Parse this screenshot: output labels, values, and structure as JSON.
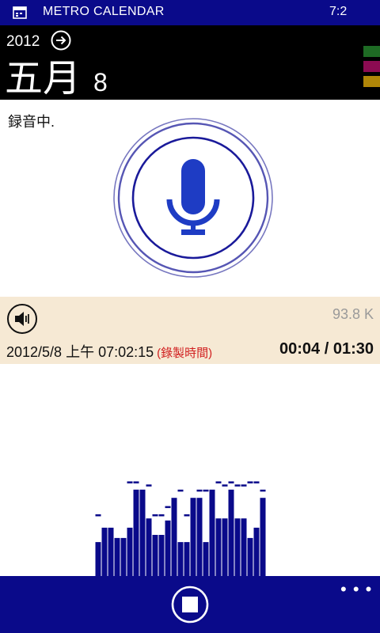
{
  "status_bar": {
    "app_title": "METRO CALENDAR",
    "time": "7:2"
  },
  "header": {
    "year": "2012",
    "month": "五月",
    "day": "8"
  },
  "calendar_colors": [
    "#1e6b24",
    "#8c0b52",
    "#b08608"
  ],
  "recording": {
    "status": "録音中."
  },
  "info": {
    "file_size": "93.8 K",
    "datetime": "2012/5/8 上午 07:02:15",
    "note": "(錄製時間)",
    "duration": "00:04 / 01:30"
  },
  "levels": {
    "bars": [
      0.33,
      0.47,
      0.47,
      0.37,
      0.37,
      0.47,
      0.84,
      0.84,
      0.56,
      0.4,
      0.4,
      0.54,
      0.76,
      0.33,
      0.33,
      0.76,
      0.76,
      0.33,
      0.84,
      0.56,
      0.56,
      0.84,
      0.56,
      0.56,
      0.37,
      0.47,
      0.76
    ],
    "peaks": [
      0.6,
      0,
      0,
      0,
      0,
      0.92,
      0.92,
      0,
      0.89,
      0.6,
      0.6,
      0.68,
      0.68,
      0.84,
      0.6,
      0.6,
      0.84,
      0.84,
      0.6,
      0.92,
      0.89,
      0.92,
      0.89,
      0.89,
      0.92,
      0.92,
      0.84
    ]
  },
  "accent_color": "#0a0a8a"
}
